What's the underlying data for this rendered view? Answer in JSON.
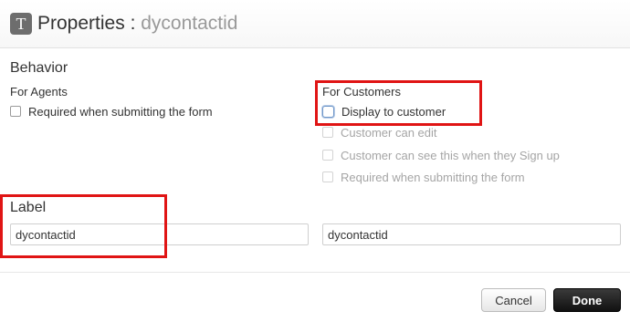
{
  "header": {
    "icon_glyph": "T",
    "title_prefix": "Properties",
    "separator": ":",
    "field_name": "dycontactid"
  },
  "behavior": {
    "heading": "Behavior",
    "agents": {
      "heading": "For Agents",
      "options": [
        {
          "label": "Required when submitting the form",
          "checked": false,
          "enabled": true
        }
      ]
    },
    "customers": {
      "heading": "For Customers",
      "options": [
        {
          "label": "Display to customer",
          "checked": false,
          "enabled": true,
          "focused": true
        },
        {
          "label": "Customer can edit",
          "checked": false,
          "enabled": false
        },
        {
          "label": "Customer can see this when they Sign up",
          "checked": false,
          "enabled": false
        },
        {
          "label": "Required when submitting the form",
          "checked": false,
          "enabled": false
        }
      ]
    }
  },
  "label_section": {
    "heading": "Label",
    "agent_value": "dycontactid",
    "customer_value": "dycontactid"
  },
  "footer": {
    "cancel_label": "Cancel",
    "done_label": "Done"
  },
  "colors": {
    "highlight": "#e01414",
    "done_button": "#1a1a1a",
    "focus_ring": "#6f96c8"
  }
}
